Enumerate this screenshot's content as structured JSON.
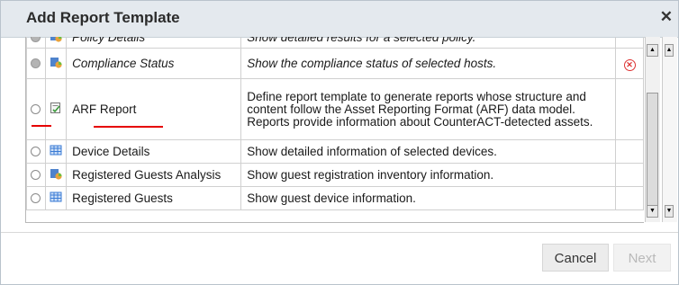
{
  "dialog": {
    "title": "Add Report Template",
    "close_icon": "close-icon"
  },
  "rows": [
    {
      "name": "Policy Details",
      "description": "Show detailed results for a selected policy.",
      "italic": true,
      "icon": "policy-chart-icon",
      "selected": false
    },
    {
      "name": "Compliance Status",
      "description": "Show the compliance status of selected hosts.",
      "italic": true,
      "icon": "compliance-chart-icon",
      "selected": false,
      "status_icon": "error-icon"
    },
    {
      "name": "ARF Report",
      "description": "Define report template to generate reports whose structure and content follow the Asset Reporting Format (ARF) data model. Reports provide information about CounterACT-detected assets.",
      "italic": false,
      "icon": "arf-report-icon",
      "selected": false
    },
    {
      "name": "Device Details",
      "description": "Show detailed information of selected devices.",
      "italic": false,
      "icon": "table-grid-icon",
      "selected": false
    },
    {
      "name": "Registered Guests Analysis",
      "description": "Show guest registration inventory information.",
      "italic": false,
      "icon": "guests-chart-icon",
      "selected": false
    },
    {
      "name": "Registered Guests",
      "description": "Show guest device information.",
      "italic": false,
      "icon": "table-grid-icon",
      "selected": false
    }
  ],
  "buttons": {
    "cancel": "Cancel",
    "next": "Next"
  },
  "colors": {
    "titlebar": "#e4e9ee",
    "annotation_red": "#e60000",
    "icon_blue": "#3a7bd5"
  }
}
